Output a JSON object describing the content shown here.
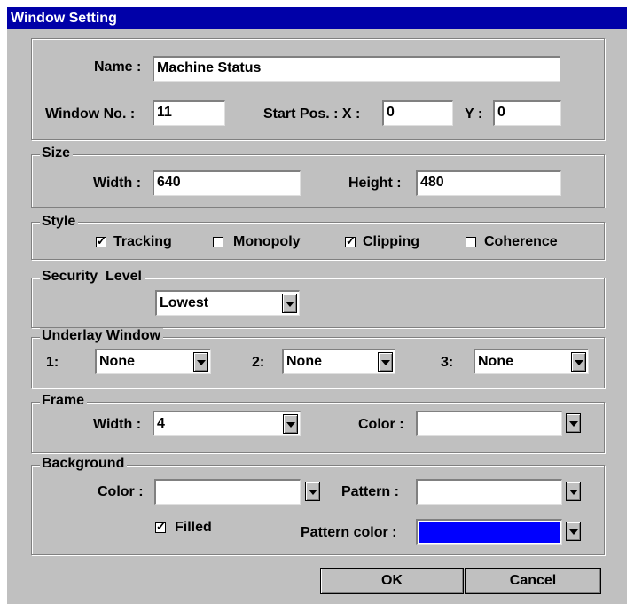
{
  "window": {
    "title": "Window Setting"
  },
  "general": {
    "name_label": "Name :",
    "name_value": "Machine Status",
    "window_no_label": "Window No. :",
    "window_no_value": "11",
    "start_pos_label": "Start Pos. : X :",
    "x_value": "0",
    "y_label": "Y :",
    "y_value": "0"
  },
  "size": {
    "legend": "Size",
    "width_label": "Width :",
    "width_value": "640",
    "height_label": "Height :",
    "height_value": "480"
  },
  "style": {
    "legend": "Style",
    "checkboxes": [
      {
        "label": "Tracking",
        "checked": true,
        "mark": "✓"
      },
      {
        "label": "Monopoly",
        "checked": false,
        "mark": ""
      },
      {
        "label": "Clipping",
        "checked": true,
        "mark": "✓"
      },
      {
        "label": "Coherence",
        "checked": false,
        "mark": ""
      }
    ]
  },
  "security": {
    "legend": "Security  Level",
    "value": "Lowest"
  },
  "underlay": {
    "legend": "Underlay Window",
    "items": [
      {
        "label": "1:",
        "value": "None"
      },
      {
        "label": "2:",
        "value": "None"
      },
      {
        "label": "3:",
        "value": "None"
      }
    ]
  },
  "frame": {
    "legend": "Frame",
    "width_label": "Width :",
    "width_value": "4",
    "color_label": "Color :",
    "color_value": "#ffffff"
  },
  "background": {
    "legend": "Background",
    "color_label": "Color :",
    "color_value": "#ffffff",
    "pattern_label": "Pattern :",
    "pattern_value": "#ffffff",
    "filled_label": "Filled",
    "filled_checked": true,
    "filled_mark": "✓",
    "pattern_color_label": "Pattern color :",
    "pattern_color_value": "#0000ff"
  },
  "buttons": {
    "ok": "OK",
    "cancel": "Cancel"
  },
  "icons": {
    "dropdown": "chevron-down-icon",
    "check": "checkmark-icon"
  },
  "colors": {
    "title_bar": "#0000a8",
    "dialog_face": "#c0c0c0"
  }
}
